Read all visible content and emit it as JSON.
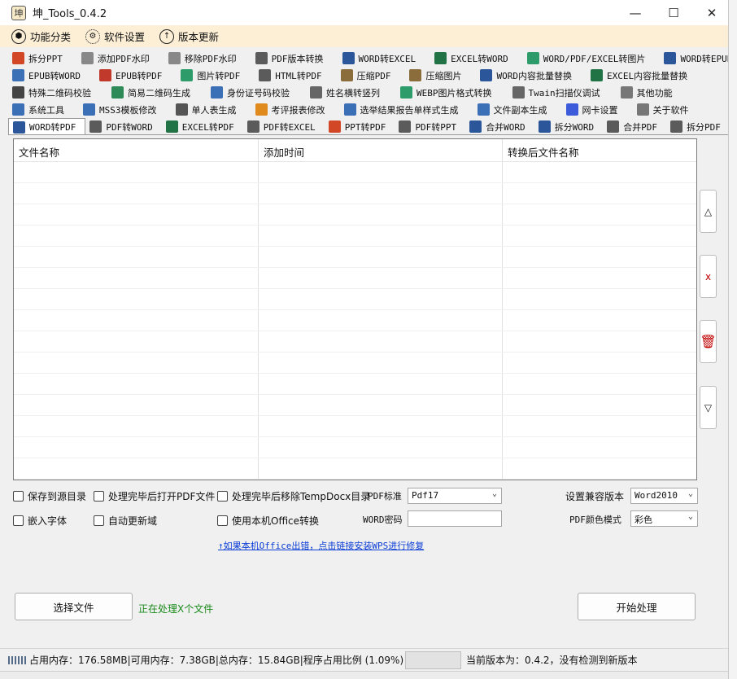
{
  "window": {
    "title": "坤_Tools_0.4.2",
    "minimize": "—",
    "maximize": "☐",
    "close": "✕"
  },
  "menubar": {
    "items": [
      {
        "label": "功能分类",
        "icon": "hexagon-icon",
        "glyph": "⬢"
      },
      {
        "label": "软件设置",
        "icon": "gear-icon",
        "glyph": "⚙"
      },
      {
        "label": "版本更新",
        "icon": "upgrade-icon",
        "glyph": "↑"
      }
    ]
  },
  "tabs": {
    "row1": [
      {
        "label": "拆分PPT",
        "color": "#d24726"
      },
      {
        "label": "添加PDF水印",
        "color": "#888888"
      },
      {
        "label": "移除PDF水印",
        "color": "#888888"
      },
      {
        "label": "PDF版本转换",
        "color": "#5b5b5b"
      },
      {
        "label": "WORD转EXCEL",
        "color": "#2b579a"
      },
      {
        "label": "EXCEL转WORD",
        "color": "#217346"
      },
      {
        "label": "WORD/PDF/EXCEL转图片",
        "color": "#2e9c6a"
      },
      {
        "label": "WORD转EPUB",
        "color": "#2b579a"
      }
    ],
    "row2": [
      {
        "label": "EPUB转WORD",
        "color": "#3b6fb6"
      },
      {
        "label": "EPUB转PDF",
        "color": "#c0392b"
      },
      {
        "label": "图片转PDF",
        "color": "#2e9c6a"
      },
      {
        "label": "HTML转PDF",
        "color": "#5b5b5b"
      },
      {
        "label": "压缩PDF",
        "color": "#8a6d3b"
      },
      {
        "label": "压缩图片",
        "color": "#8a6d3b"
      },
      {
        "label": "WORD内容批量替换",
        "color": "#2b579a"
      },
      {
        "label": "EXCEL内容批量替换",
        "color": "#217346"
      }
    ],
    "row3": [
      {
        "label": "特殊二维码校验",
        "color": "#444444"
      },
      {
        "label": "简易二维码生成",
        "color": "#2e8b57"
      },
      {
        "label": "身份证号码校验",
        "color": "#3b6fb6"
      },
      {
        "label": "姓名横转竖列",
        "color": "#666666"
      },
      {
        "label": "WEBP图片格式转换",
        "color": "#2e9c6a"
      },
      {
        "label": "Twain扫描仪调试",
        "color": "#666666"
      },
      {
        "label": "其他功能",
        "color": "#777777"
      }
    ],
    "row4": [
      {
        "label": "系统工具",
        "color": "#3b6fb6"
      },
      {
        "label": "MSS3模板修改",
        "color": "#3b6fb6"
      },
      {
        "label": "单人表生成",
        "color": "#555555"
      },
      {
        "label": "考评报表修改",
        "color": "#e08a1e"
      },
      {
        "label": "选举结果报告单样式生成",
        "color": "#3b6fb6"
      },
      {
        "label": "文件副本生成",
        "color": "#3b6fb6"
      },
      {
        "label": "网卡设置",
        "color": "#3b5bdb"
      },
      {
        "label": "关于软件",
        "color": "#777777"
      }
    ],
    "row5": [
      {
        "label": "WORD转PDF",
        "color": "#2b579a"
      },
      {
        "label": "PDF转WORD",
        "color": "#5b5b5b"
      },
      {
        "label": "EXCEL转PDF",
        "color": "#217346"
      },
      {
        "label": "PDF转EXCEL",
        "color": "#5b5b5b"
      },
      {
        "label": "PPT转PDF",
        "color": "#d24726"
      },
      {
        "label": "PDF转PPT",
        "color": "#5b5b5b"
      },
      {
        "label": "合并WORD",
        "color": "#2b579a"
      },
      {
        "label": "拆分WORD",
        "color": "#2b579a"
      },
      {
        "label": "合并PDF",
        "color": "#5b5b5b"
      },
      {
        "label": "拆分PDF",
        "color": "#5b5b5b"
      }
    ]
  },
  "table": {
    "columns": [
      "文件名称",
      "添加时间",
      "转换后文件名称"
    ],
    "rows": []
  },
  "side_buttons": {
    "up": "△",
    "remove": "x",
    "delete": "🗑",
    "down": "▽"
  },
  "options": {
    "save_to_source": "保存到源目录",
    "open_pdf_after": "处理完毕后打开PDF文件",
    "remove_tempdocx": "处理完毕后移除TempDocx目录",
    "embed_fonts": "嵌入字体",
    "auto_update_fields": "自动更新域",
    "use_local_office": "使用本机Office转换",
    "pdf_standard_label": "PDF标准",
    "pdf_standard_value": "Pdf17",
    "word_password_label": "WORD密码",
    "word_password_value": "",
    "compat_version_label": "设置兼容版本",
    "compat_version_value": "Word2010",
    "pdf_color_label": "PDF颜色模式",
    "pdf_color_value": "彩色"
  },
  "wps_link": "↑如果本机Office出错，点击链接安装WPS进行修复",
  "actions": {
    "select_files": "选择文件",
    "processing_status": "正在处理X个文件",
    "start": "开始处理"
  },
  "status": {
    "memory": "占用内存：176.58MB|可用内存：7.38GB|总内存：15.84GB|程序占用比例 (1.09%)",
    "version": "当前版本为：0.4.2，没有检测到新版本"
  }
}
